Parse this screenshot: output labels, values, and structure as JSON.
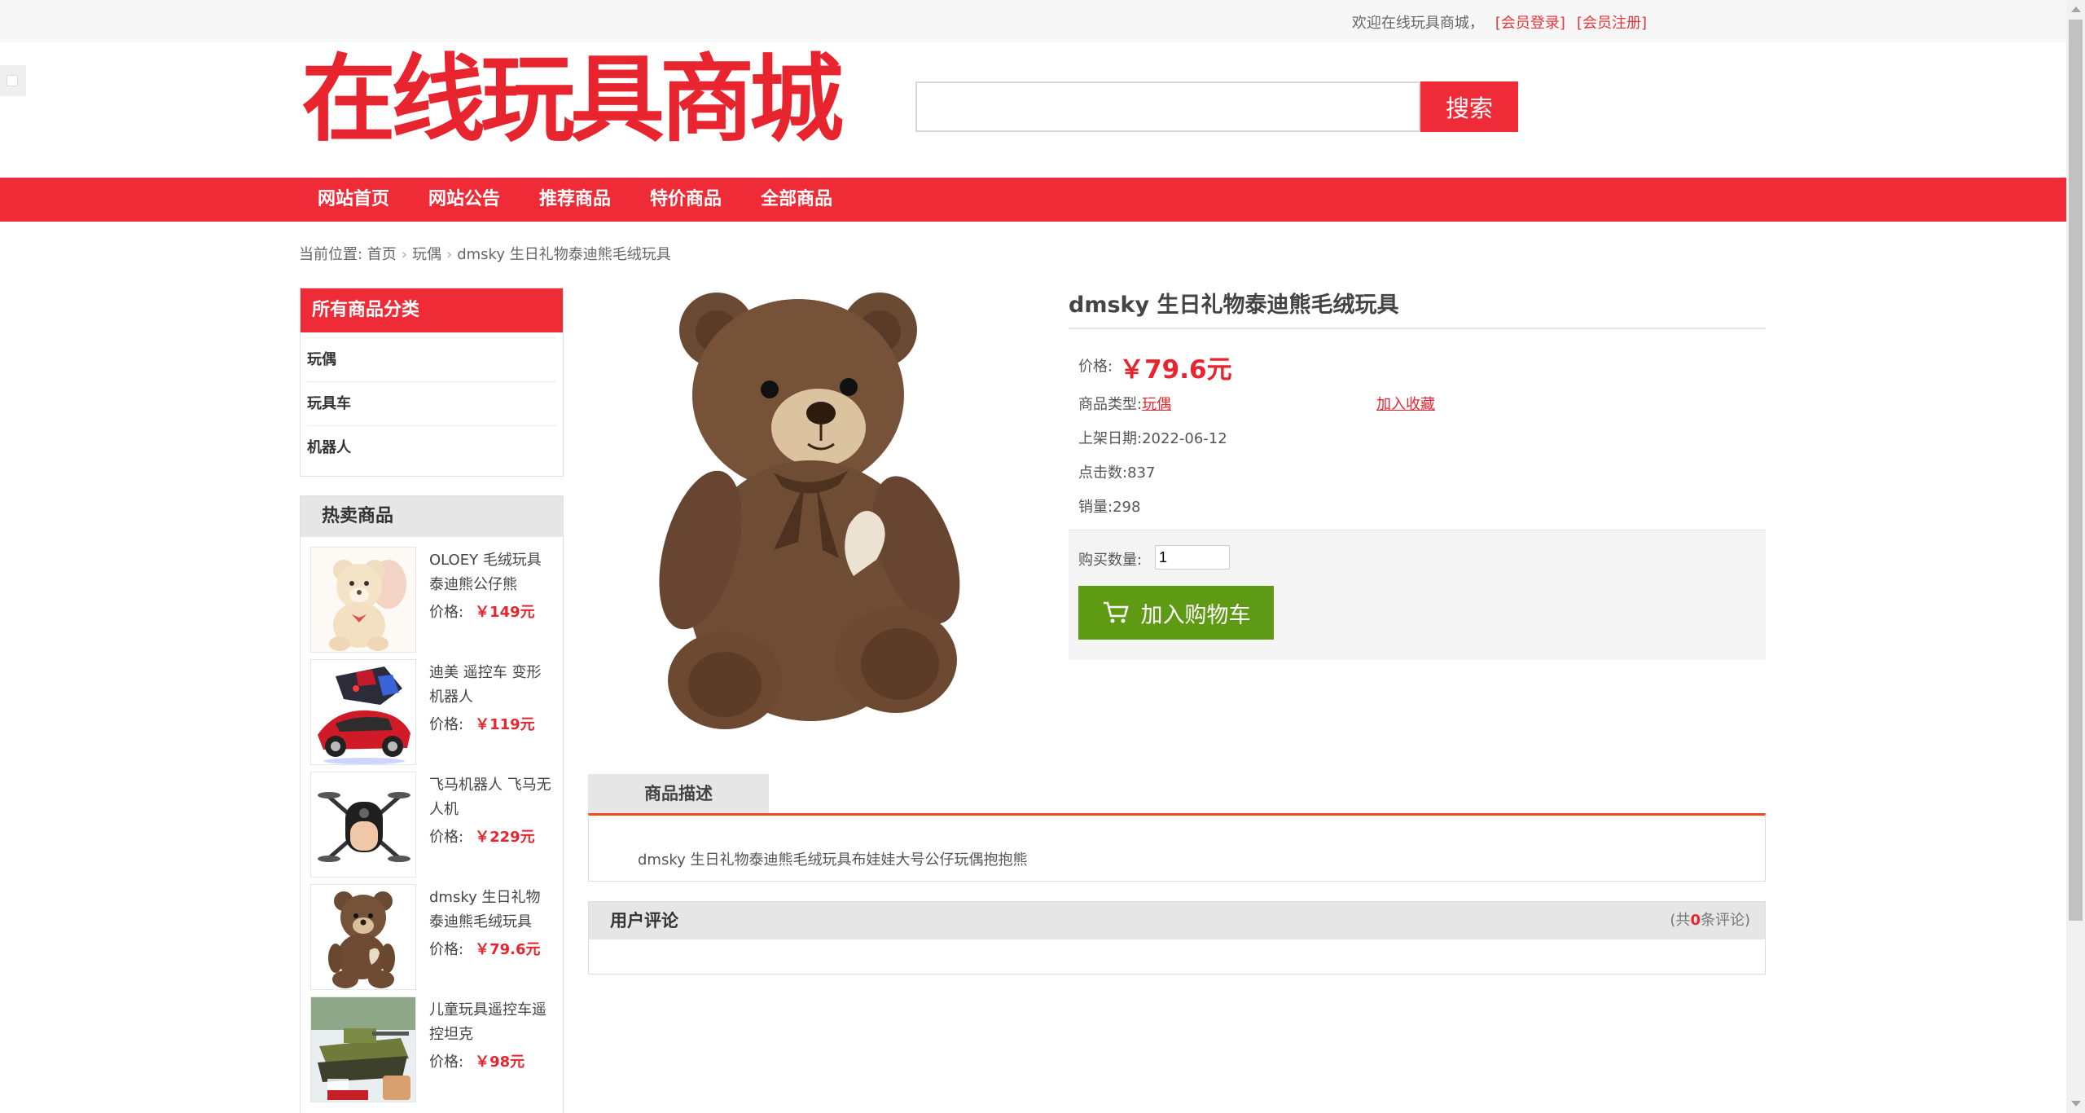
{
  "topbar": {
    "welcome": "欢迎在线玩具商城，",
    "login": "[会员登录]",
    "register": "[会员注册]"
  },
  "header": {
    "logo_text": "在线玩具商城",
    "search_placeholder": "",
    "search_button": "搜索"
  },
  "nav": {
    "items": [
      "网站首页",
      "网站公告",
      "推荐商品",
      "特价商品",
      "全部商品"
    ]
  },
  "breadcrumb": {
    "prefix": "当前位置: ",
    "home": "首页",
    "category": "玩偶",
    "current": "dmsky 生日礼物泰迪熊毛绒玩具"
  },
  "sidebar": {
    "categories_title": "所有商品分类",
    "categories": [
      "玩偶",
      "玩具车",
      "机器人"
    ],
    "hot_title": "热卖商品",
    "hot_items": [
      {
        "name": "OLOEY 毛绒玩具泰迪熊公仔熊",
        "price_label": "价格:",
        "price": "￥149元"
      },
      {
        "name": "迪美 遥控车 变形机器人",
        "price_label": "价格:",
        "price": "￥119元"
      },
      {
        "name": "飞马机器人 飞马无人机",
        "price_label": "价格:",
        "price": "￥229元"
      },
      {
        "name": "dmsky 生日礼物泰迪熊毛绒玩具",
        "price_label": "价格:",
        "price": "￥79.6元"
      },
      {
        "name": "儿童玩具遥控车遥控坦克",
        "price_label": "价格:",
        "price": "￥98元"
      }
    ]
  },
  "product": {
    "title": "dmsky 生日礼物泰迪熊毛绒玩具",
    "price_label": "价格:",
    "price": "￥79.6元",
    "type_label": "商品类型:",
    "type": "玩偶",
    "favorite": "加入收藏",
    "date_label": "上架日期:",
    "date": "2022-06-12",
    "clicks_label": "点击数:",
    "clicks": "837",
    "sales_label": "销量:",
    "sales": "298",
    "qty_label": "购买数量:",
    "qty": "1",
    "cart_button": "加入购物车"
  },
  "description": {
    "tab": "商品描述",
    "text": "dmsky 生日礼物泰迪熊毛绒玩具布娃娃大号公仔玩偶抱抱熊"
  },
  "reviews": {
    "title": "用户评论",
    "count_prefix": "(共",
    "count": "0",
    "count_suffix": "条评论)"
  },
  "colors": {
    "brand_red": "#ee2b36",
    "price_red": "#e8252e",
    "cart_green": "#5f9a14"
  }
}
